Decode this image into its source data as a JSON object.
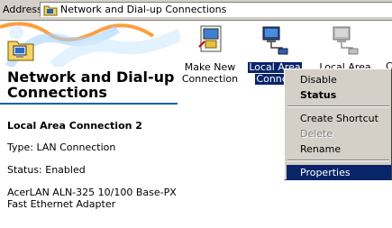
{
  "address_bar": {
    "label": "Address",
    "path": "Network and Dial-up Connections"
  },
  "left_pane": {
    "title": "Network and Dial-up Connections",
    "details": {
      "name": "Local Area Connection 2",
      "type": "Type: LAN Connection",
      "status": "Status: Enabled",
      "adapter": "AcerLAN ALN-325 10/100 Base-PX Fast Ethernet Adapter"
    }
  },
  "icons": [
    {
      "label_line1": "Make New",
      "label_line2": "Connection",
      "icon": "make-new-connection-icon"
    },
    {
      "label_line1": "Local Area",
      "label_line2": "Connec",
      "icon": "network-connection-icon",
      "selected": true
    },
    {
      "label_line1": "Local Area",
      "label_line2": "",
      "icon": "network-connection-disabled-icon"
    },
    {
      "label_line1": "C",
      "label_line2": "",
      "icon": "partial-icon"
    }
  ],
  "context_menu": {
    "items": [
      "Disable",
      "Status",
      "Create Shortcut",
      "Delete",
      "Rename",
      "Properties"
    ]
  },
  "colors": {
    "selection": "#0a246a",
    "face": "#d4d0c8",
    "divider": "#0a64a4"
  }
}
